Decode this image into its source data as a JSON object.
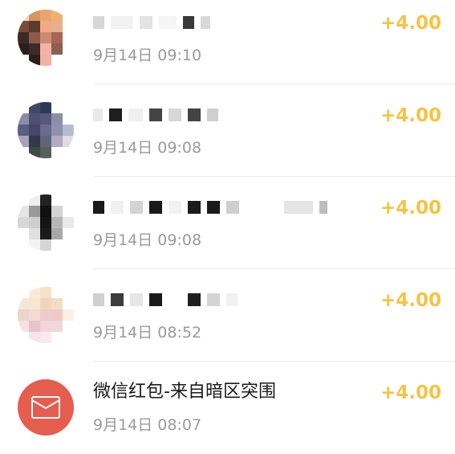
{
  "transactions": [
    {
      "title": "",
      "time": "9月14日 09:10",
      "amount": "+4.00",
      "avatar": "blurred-photo"
    },
    {
      "title": "",
      "time": "9月14日 09:08",
      "amount": "+4.00",
      "avatar": "blurred-photo"
    },
    {
      "title": "",
      "time": "9月14日 09:08",
      "amount": "+4.00",
      "avatar": "blurred-photo"
    },
    {
      "title": "",
      "time": "9月14日 08:52",
      "amount": "+4.00",
      "avatar": "blurred-photo"
    },
    {
      "title": "微信红包-来自暗区突围",
      "time": "9月14日 08:07",
      "amount": "+4.00",
      "avatar": "red-packet-icon"
    }
  ],
  "colors": {
    "amount": "#f6c343",
    "red_packet": "#e45d4f",
    "time_text": "#9a9a9a"
  }
}
